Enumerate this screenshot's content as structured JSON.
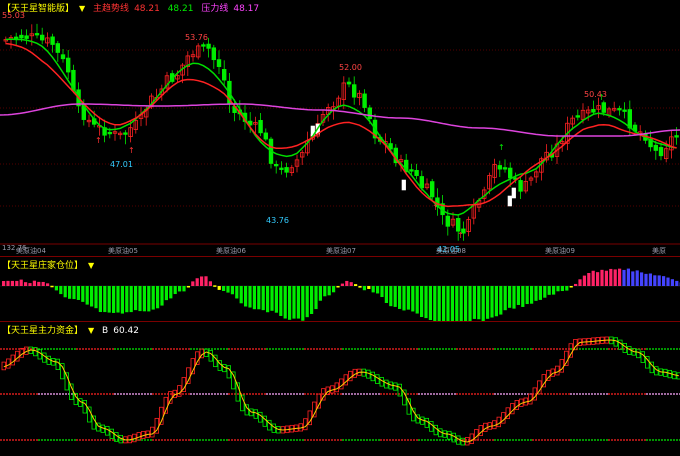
{
  "main": {
    "title": "【天王星智能版】",
    "line1_label": "主趋势线",
    "line1_value": "48.21",
    "line2_value": "48.21",
    "line3_label": "压力线",
    "line3_value": "48.17",
    "top_price": "55.03",
    "dates": [
      "美原油04",
      "美原油05",
      "美原油06",
      "美原油07",
      "美原油08",
      "美原油09",
      "美原"
    ],
    "axis_label": "132.76",
    "peaks": [
      {
        "text": "53.76",
        "color": "#ff4444"
      },
      {
        "text": "52.00",
        "color": "#ff4444"
      },
      {
        "text": "50.43",
        "color": "#ff4444"
      },
      {
        "text": "47.01",
        "color": "#33ccff"
      },
      {
        "text": "43.76",
        "color": "#33ccff"
      },
      {
        "text": "42.05",
        "color": "#33ccff"
      }
    ]
  },
  "position_panel": {
    "title": "【天王星庄家仓位】"
  },
  "fund_panel": {
    "title": "【天王星主力资金】",
    "b_label": "B",
    "b_value": "60.42"
  },
  "colors": {
    "up": "#ff2222",
    "down": "#00ee00",
    "fast_ma": "#00dd00",
    "slow_ma": "#ff2222",
    "long_ma": "#dd44dd",
    "yellow": "#ffff00",
    "grid": "#aa0000"
  }
}
